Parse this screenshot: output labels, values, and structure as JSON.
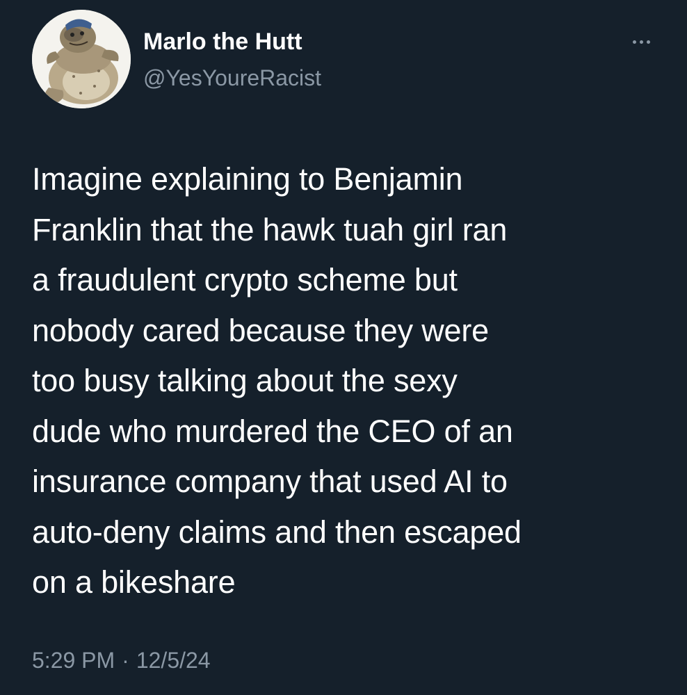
{
  "author": {
    "display_name": "Marlo the Hutt",
    "handle": "@YesYoureRacist",
    "avatar_icon": "hutt-figurine-avatar"
  },
  "more_icon": "more-horizontal-icon",
  "tweet": {
    "lines": [
      "Imagine explaining to Benjamin",
      "Franklin that the hawk tuah girl ran",
      "a fraudulent crypto scheme but",
      "nobody cared because they were",
      "too busy talking about the sexy",
      "dude who murdered the CEO of an",
      "insurance company that used AI to",
      "auto-deny claims and then escaped",
      "on a bikeshare"
    ]
  },
  "meta": {
    "time": "5:29 PM",
    "separator": "·",
    "date": "12/5/24"
  },
  "colors": {
    "background": "#15202b",
    "primary_text": "#ffffff",
    "secondary_text": "#8b98a5"
  }
}
